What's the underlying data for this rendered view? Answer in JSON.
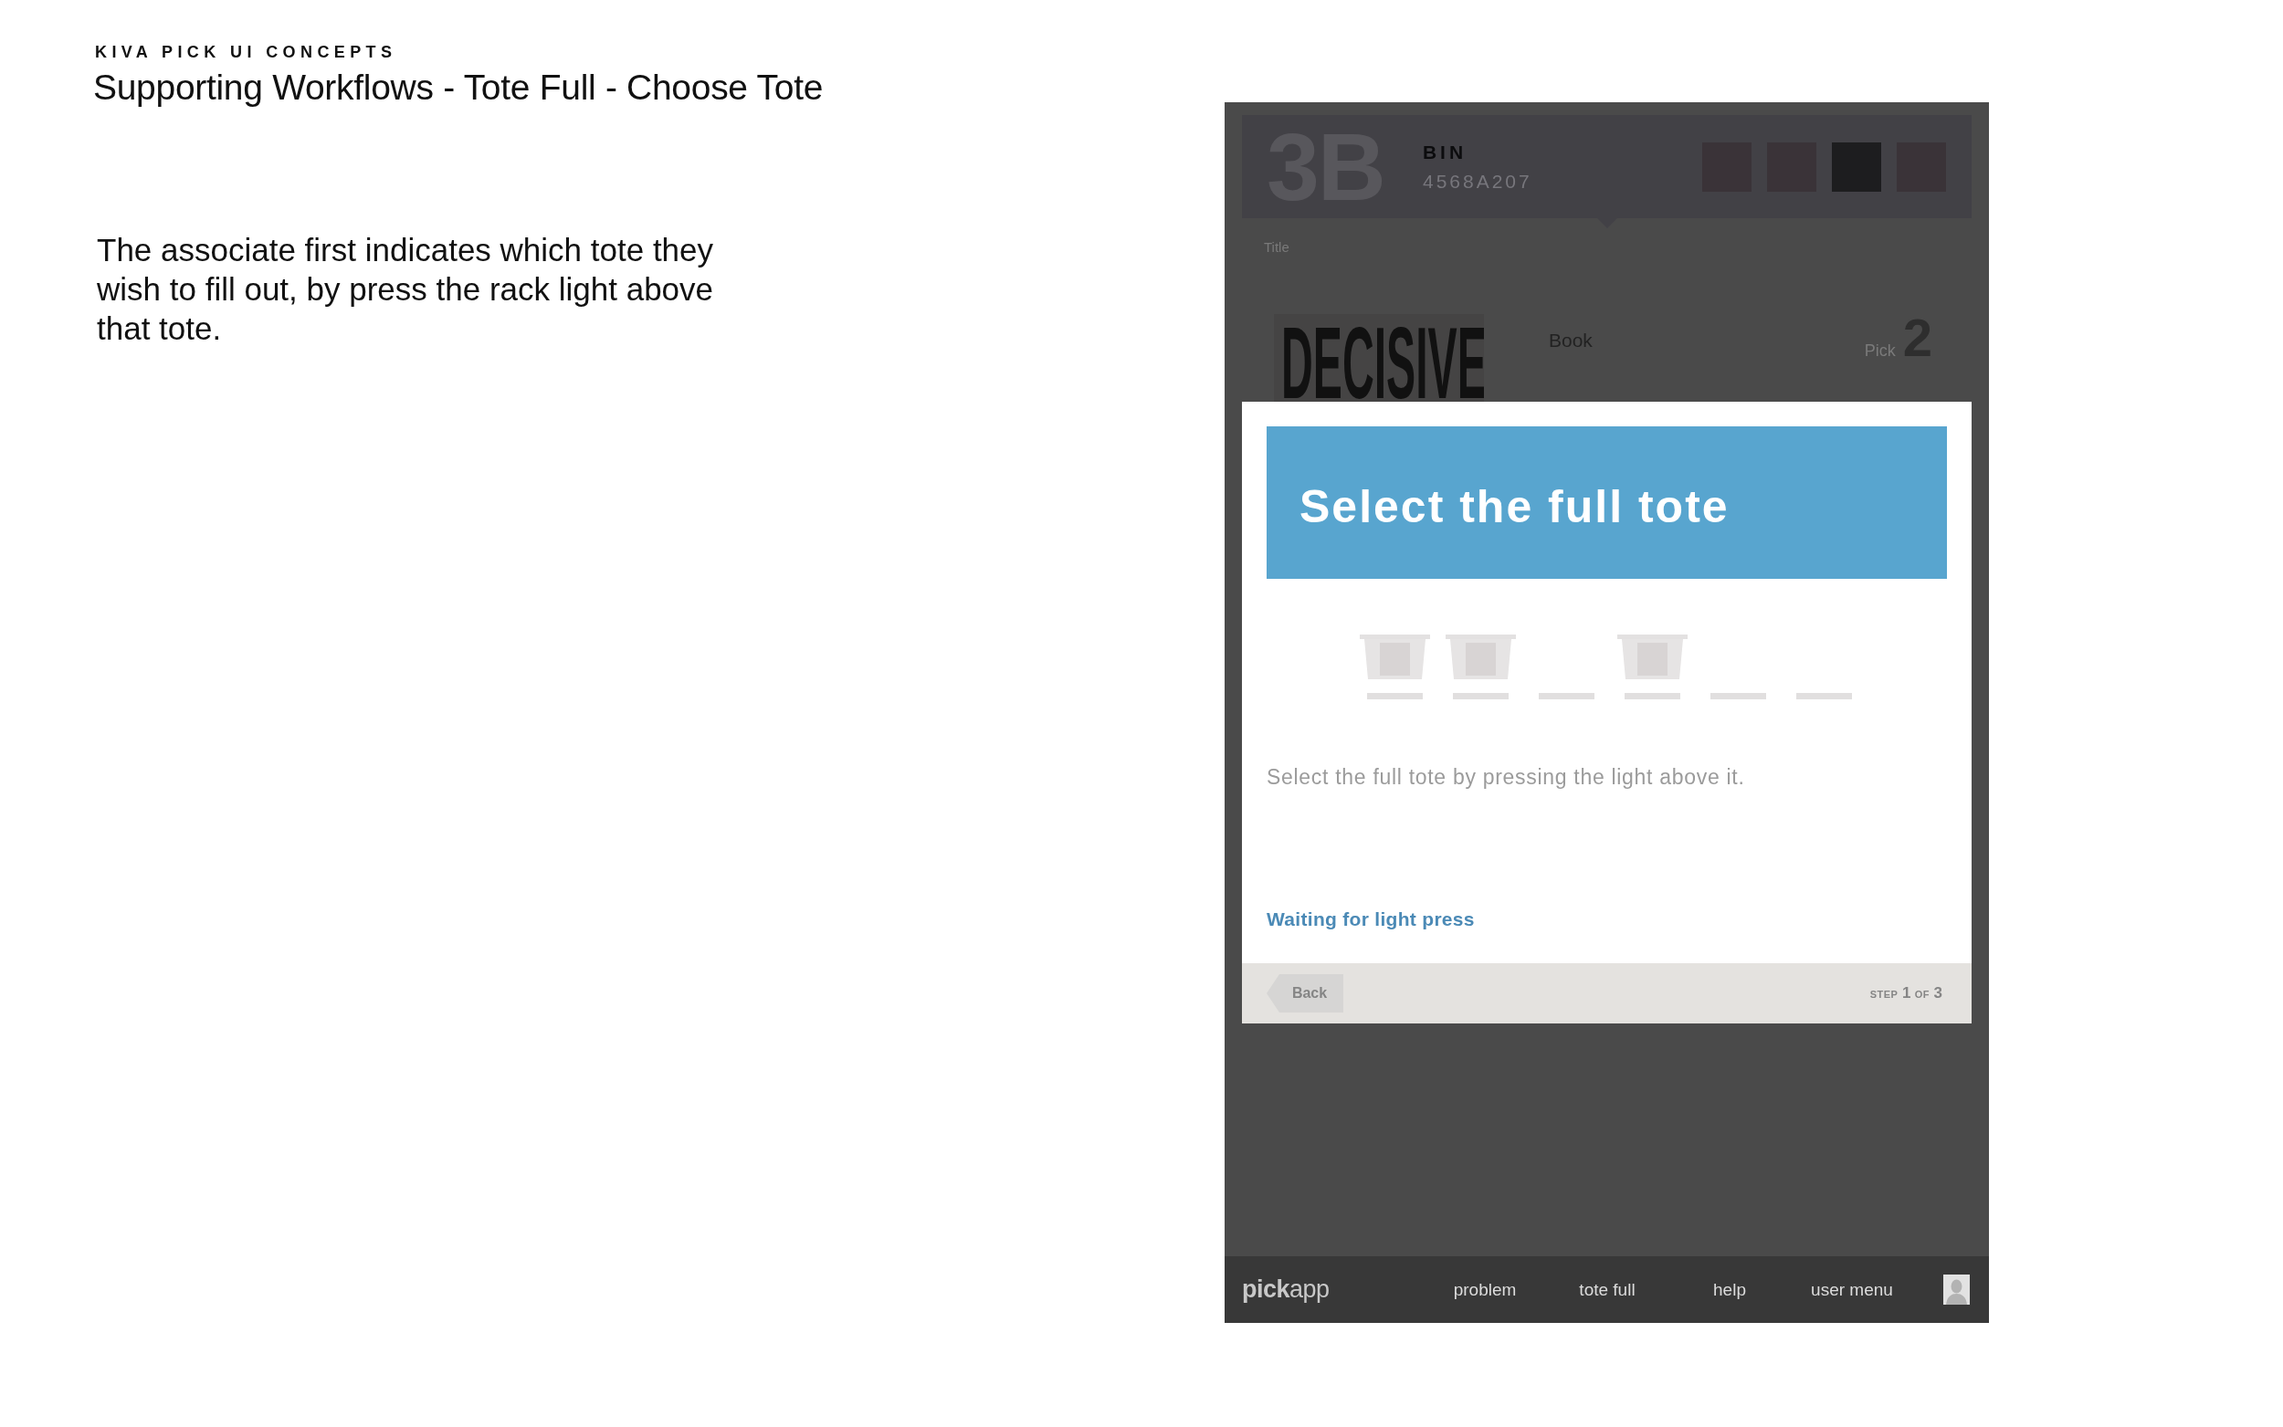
{
  "deck": {
    "kicker": "KIVA PICK UI CONCEPTS",
    "title": "Supporting Workflows - Tote Full - Choose Tote",
    "description": "The associate first indicates which tote they wish to fill out, by press the rack light above that tote."
  },
  "device": {
    "bin": {
      "code": "3B",
      "label": "BIN",
      "bin_number": "4568A207",
      "indicators": [
        {
          "color": "#3a3338"
        },
        {
          "color": "#3a3338"
        },
        {
          "color": "#1d1d1f"
        },
        {
          "color": "#3a3338"
        }
      ]
    },
    "section_label": "Title",
    "item": {
      "cover_text": "DECISIVE",
      "type": "Book",
      "pick_label": "Pick",
      "quantity": "2"
    },
    "dialog": {
      "title": "Select the full tote",
      "slots": [
        {
          "has_tote": true
        },
        {
          "has_tote": true
        },
        {
          "has_tote": false
        },
        {
          "has_tote": true
        },
        {
          "has_tote": false
        },
        {
          "has_tote": false
        }
      ],
      "instruction": "Select the full tote by pressing the light above it.",
      "status": "Waiting for light press",
      "back_button": "Back",
      "step": {
        "label": "STEP",
        "current": "1",
        "joiner": "OF",
        "total": "3"
      }
    },
    "nav": {
      "logo": "**pick**app",
      "items": [
        "problem",
        "tote full",
        "help",
        "user menu"
      ]
    }
  }
}
